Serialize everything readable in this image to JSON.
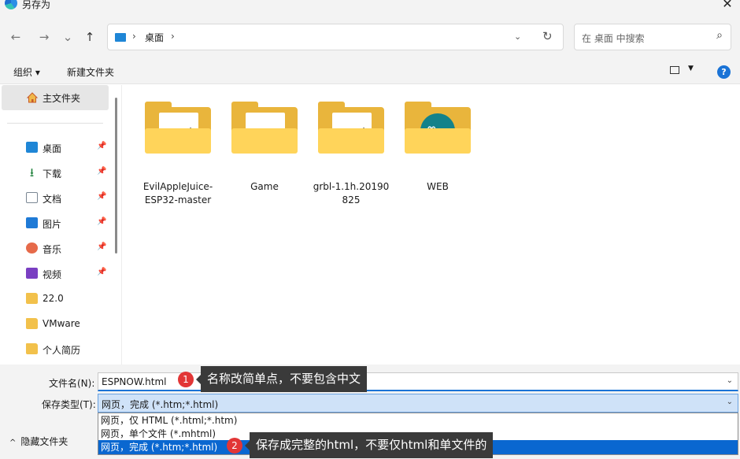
{
  "window": {
    "title": "另存为",
    "close_glyph": "✕"
  },
  "nav": {
    "back": "←",
    "forward": "→",
    "recent": "⌄",
    "up": "↑"
  },
  "address": {
    "sep1": "›",
    "crumb": "桌面",
    "sep2": "›",
    "dropdown": "⌄",
    "refresh": "↻"
  },
  "search": {
    "placeholder": "在 桌面 中搜索",
    "icon": "⌕"
  },
  "toolbar": {
    "organize": "组织 ▾",
    "new_folder": "新建文件夹",
    "view_dd": "▼",
    "help": "?"
  },
  "sidebar": {
    "home": "主文件夹",
    "items": [
      {
        "label": "桌面",
        "icon": "desktop-icon",
        "pinned": true
      },
      {
        "label": "下载",
        "icon": "download-icon",
        "pinned": true
      },
      {
        "label": "文档",
        "icon": "document-icon",
        "pinned": true
      },
      {
        "label": "图片",
        "icon": "pictures-icon",
        "pinned": true
      },
      {
        "label": "音乐",
        "icon": "music-icon",
        "pinned": true
      },
      {
        "label": "视频",
        "icon": "video-icon",
        "pinned": true
      },
      {
        "label": "22.0",
        "icon": "folder-icon",
        "pinned": false
      },
      {
        "label": "VMware",
        "icon": "folder-icon",
        "pinned": false
      },
      {
        "label": "个人简历",
        "icon": "folder-icon",
        "pinned": false
      }
    ],
    "pin_glyph": "📌"
  },
  "files": [
    {
      "name": "EvilAppleJuice-ESP32-master",
      "line1": "EvilAppleJuice-",
      "line2": "ESP32-master"
    },
    {
      "name": "Game",
      "line1": "Game",
      "line2": ""
    },
    {
      "name": "grbl-1.1h.20190825",
      "line1": "grbl-1.1h.20190",
      "line2": "825"
    },
    {
      "name": "WEB",
      "line1": "WEB",
      "line2": ""
    }
  ],
  "form": {
    "filename_label": "文件名(N):",
    "filename_value": "ESPNOW.html",
    "type_label": "保存类型(T):",
    "type_value": "网页，完成 (*.htm;*.html)",
    "dropdown": "⌄",
    "options": [
      "网页，仅 HTML (*.html;*.htm)",
      "网页，单个文件 (*.mhtml)",
      "网页，完成 (*.htm;*.html)"
    ],
    "hide_folders": "隐藏文件夹",
    "hide_chevron": "^"
  },
  "annotations": [
    {
      "badge": "1",
      "text": "名称改简单点，不要包含中文"
    },
    {
      "badge": "2",
      "text": "保存成完整的html，不要仅html和单文件的"
    }
  ],
  "colors": {
    "accent": "#1a73d6",
    "folder": "#ffd45a",
    "badge": "#e23636",
    "tip": "#3a3a3a"
  }
}
